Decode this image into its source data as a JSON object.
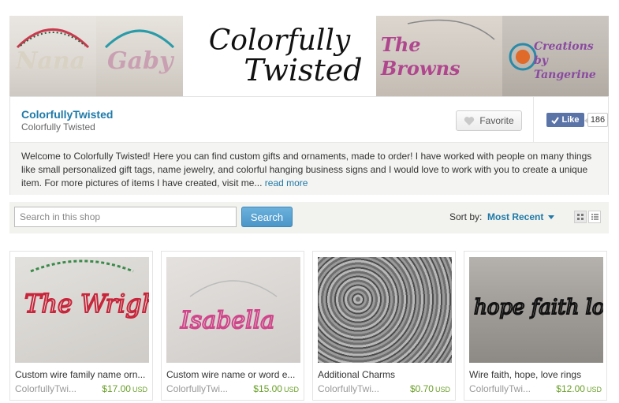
{
  "banner": {
    "logo_line1": "Colorfully",
    "logo_line2": "Twisted",
    "wire_words": [
      "Nana",
      "Gaby",
      "The Browns",
      "Creations by Tangerine"
    ]
  },
  "shop": {
    "name": "ColorfullyTwisted",
    "subtitle": "Colorfully Twisted",
    "favorite_label": "Favorite",
    "like_label": "Like",
    "like_count": "186",
    "welcome": "Welcome to Colorfully Twisted! Here you can find custom gifts and ornaments, made to order! I have worked with people on many things like small personalized gift tags, name jewelry, and colorful hanging business signs and I would love to work with you to create a unique item. For more pictures of items I have created, visit me...",
    "read_more": "read more"
  },
  "search": {
    "placeholder": "Search in this shop",
    "button_label": "Search",
    "sort_label": "Sort by:",
    "sort_value": "Most Recent"
  },
  "listings": [
    {
      "title": "Custom wire family name orn...",
      "shop": "ColorfullyTwi...",
      "price": "$17.00",
      "currency": "USD",
      "thumb_text": "The Wrights"
    },
    {
      "title": "Custom wire name or word e...",
      "shop": "ColorfullyTwi...",
      "price": "$15.00",
      "currency": "USD",
      "thumb_text": "Isabella"
    },
    {
      "title": "Additional Charms",
      "shop": "ColorfullyTwi...",
      "price": "$0.70",
      "currency": "USD",
      "thumb_text": ""
    },
    {
      "title": "Wire faith, hope, love rings",
      "shop": "ColorfullyTwi...",
      "price": "$12.00",
      "currency": "USD",
      "thumb_text": "hope faith love"
    }
  ],
  "colors": {
    "link": "#1f7aa8",
    "price": "#6a9f2a",
    "facebook": "#5b74a8",
    "search_button": "#4b95c8"
  }
}
